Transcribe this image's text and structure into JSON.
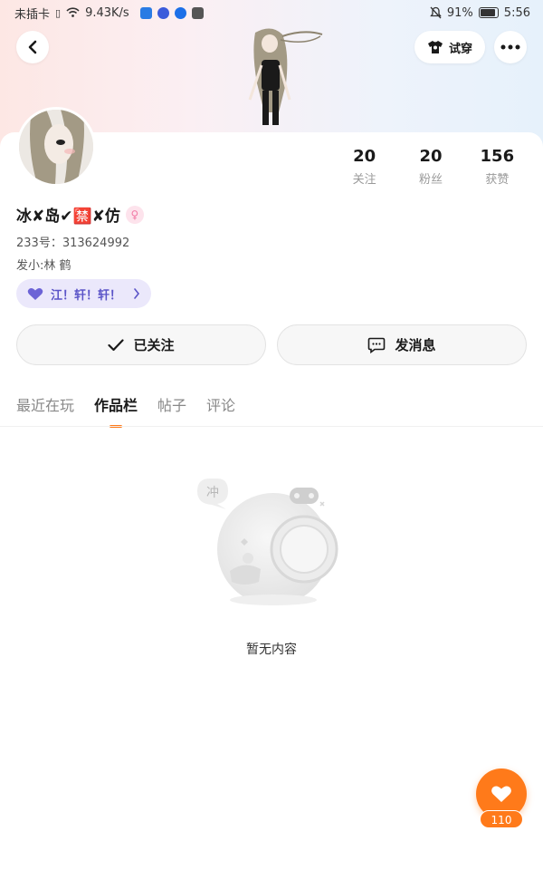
{
  "status_bar": {
    "carrier": "未插卡",
    "net_speed": "9.43K/s",
    "battery": "91%",
    "time": "5:56"
  },
  "header": {
    "try_on_label": "试穿"
  },
  "profile": {
    "username": "冰✘岛✔🈲✘仿",
    "uid": "233号：313624992",
    "bio": "发小:林 鹤",
    "medal_label": "江！轩！轩！",
    "stats": [
      {
        "value": "20",
        "label": "关注"
      },
      {
        "value": "20",
        "label": "粉丝"
      },
      {
        "value": "156",
        "label": "获赞"
      }
    ]
  },
  "actions": {
    "follow_label": "已关注",
    "message_label": "发消息"
  },
  "tabs": [
    "最近在玩",
    "作品栏",
    "帖子",
    "评论"
  ],
  "active_tab": "作品栏",
  "empty": {
    "badge": "冲",
    "text": "暂无内容"
  },
  "like": {
    "count": "110"
  },
  "colors": {
    "accent": "#ff7a1a",
    "medal_text": "#5b54c8",
    "medal_bg": "#ebe8fb"
  }
}
